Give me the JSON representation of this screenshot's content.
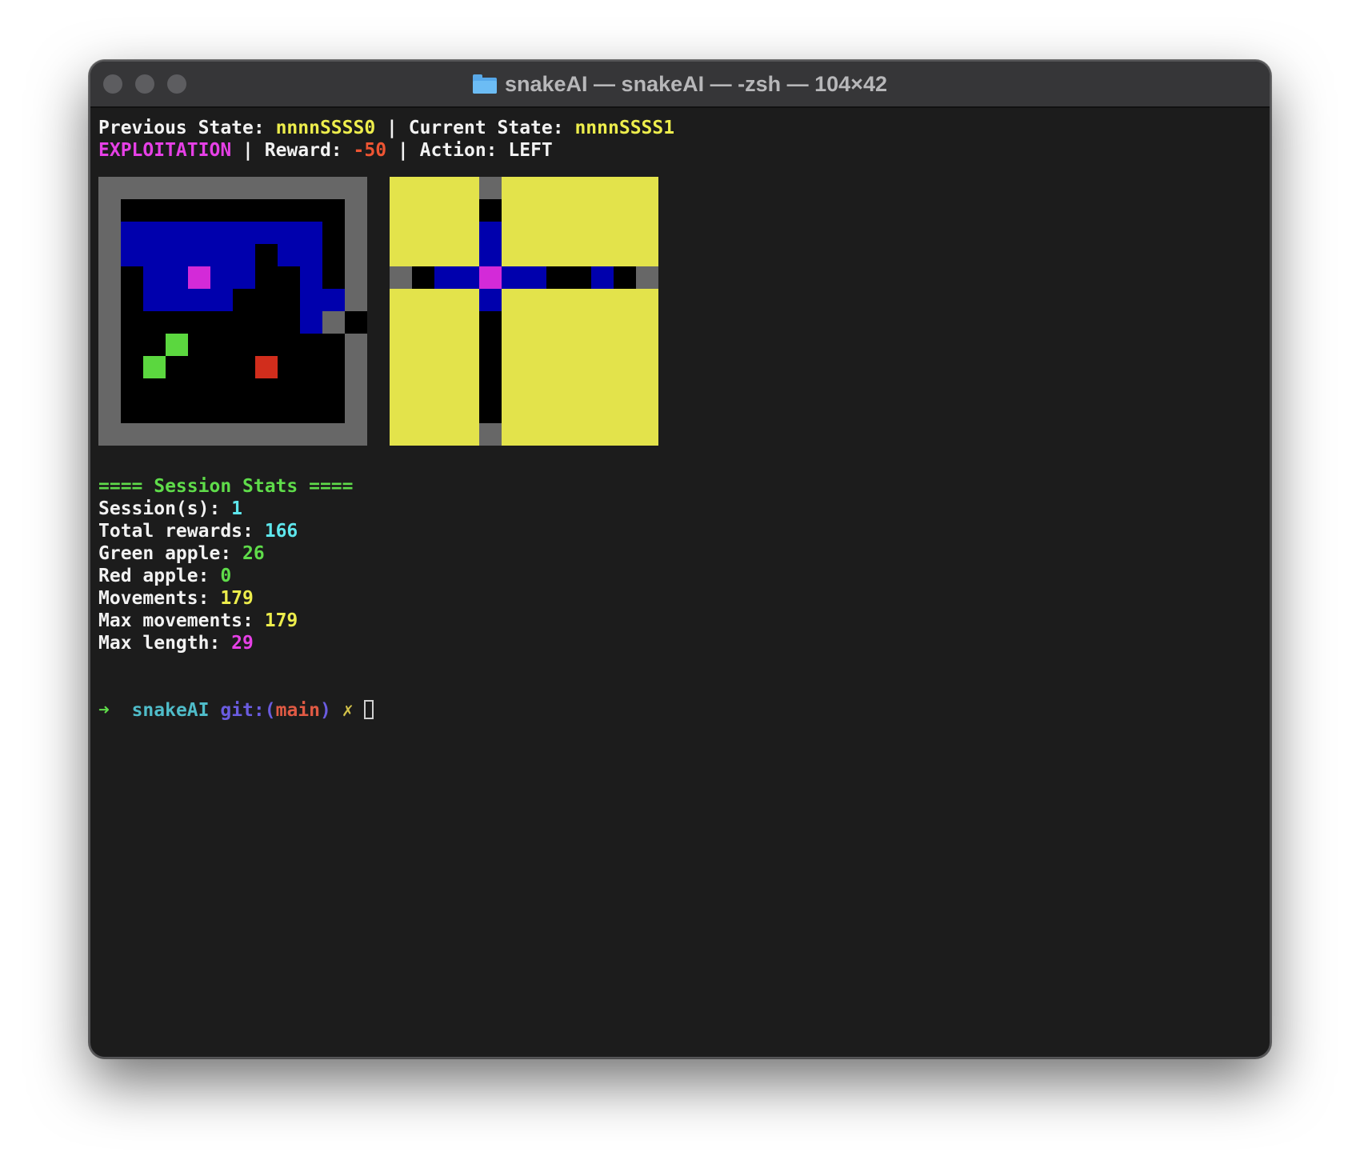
{
  "window": {
    "title": "snakeAI — snakeAI — -zsh — 104×42"
  },
  "terminal": {
    "line1": {
      "prev_label": "Previous State: ",
      "prev_value": "nnnnSSSS0",
      "sep": " | ",
      "curr_label": "Current State: ",
      "curr_value": "nnnnSSSS1"
    },
    "line2": {
      "mode": "EXPLOITATION",
      "sep1": " | ",
      "reward_label": "Reward: ",
      "reward_value": "-50",
      "sep2": " | ",
      "action_label": "Action: ",
      "action_value": "LEFT"
    },
    "stats": {
      "header": "==== Session Stats ====",
      "rows": [
        {
          "label": "Session(s): ",
          "value": "1",
          "color": "cyan"
        },
        {
          "label": "Total rewards: ",
          "value": "166",
          "color": "cyan"
        },
        {
          "label": "Green apple: ",
          "value": "26",
          "color": "green"
        },
        {
          "label": "Red apple: ",
          "value": "0",
          "color": "green"
        },
        {
          "label": "Movements: ",
          "value": "179",
          "color": "yellow"
        },
        {
          "label": "Max movements: ",
          "value": "179",
          "color": "yellow"
        },
        {
          "label": "Max length: ",
          "value": "29",
          "color": "magenta"
        }
      ]
    },
    "prompt": {
      "arrow": "➜",
      "dir": "snakeAI",
      "git": "git:(",
      "branch": "main",
      "git_close": ")",
      "dirty": "✗"
    }
  },
  "colors": {
    "wall": "#676767",
    "empty": "#000000",
    "snake_body": "#0000ad",
    "snake_head": "#d32ad8",
    "green_apple": "#5bd73f",
    "red_apple": "#d12d1c",
    "unseen": "#e3e34b"
  },
  "boards": {
    "legend": {
      "W": "wall",
      ".": "empty",
      "B": "snake_body",
      "H": "snake_head",
      "G": "green_apple",
      "R": "red_apple",
      "Y": "unseen"
    },
    "game": [
      "WWWWWWWWWWWW",
      "W..........W",
      "WBBBBBBBBB.W",
      "WBBBBBB.BB.W",
      "W.BBHBB..B.W",
      "W.BBBB...BBW",
      "W........BW",
      "W..G.......W",
      "W.G....R...W",
      "W..........W",
      "W..........W",
      "WWWWWWWWWWWW"
    ],
    "vision": [
      "YYYYWYYYYYYY",
      "YYYY.YYYYYYY",
      "YYYYBYYYYYYY",
      "YYYYBYYYYYYY",
      "W.BBHBB..B.W",
      "YYYYBYYYYYYY",
      "YYYY.YYYYYYY",
      "YYYY.YYYYYYY",
      "YYYY.YYYYYYY",
      "YYYY.YYYYYYY",
      "YYYY.YYYYYYY",
      "YYYYWYYYYYYY"
    ]
  }
}
